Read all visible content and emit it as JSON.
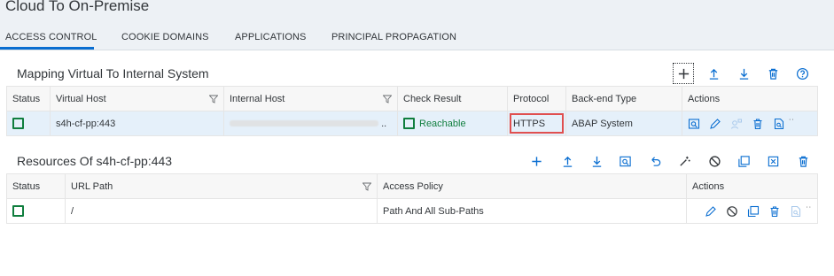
{
  "page": {
    "title": "Cloud To On-Premise"
  },
  "tabs": [
    {
      "label": "ACCESS CONTROL"
    },
    {
      "label": "COOKIE DOMAINS"
    },
    {
      "label": "APPLICATIONS"
    },
    {
      "label": "PRINCIPAL PROPAGATION"
    }
  ],
  "mapping": {
    "title": "Mapping Virtual To Internal System",
    "columns": {
      "status": "Status",
      "virtual_host": "Virtual Host",
      "internal_host": "Internal Host",
      "check_result": "Check Result",
      "protocol": "Protocol",
      "backend_type": "Back-end Type",
      "actions": "Actions"
    },
    "rows": [
      {
        "virtual_host": "s4h-cf-pp:443",
        "internal_host_suffix": "..",
        "check_result": "Reachable",
        "protocol": "HTTPS",
        "backend_type": "ABAP System"
      }
    ]
  },
  "resources": {
    "title": "Resources Of s4h-cf-pp:443",
    "columns": {
      "status": "Status",
      "url_path": "URL Path",
      "access_policy": "Access Policy",
      "actions": "Actions"
    },
    "rows": [
      {
        "url_path": "/",
        "access_policy": "Path And All Sub-Paths"
      }
    ]
  },
  "more_glyph": "˙˙",
  "colors": {
    "accent": "#0a6ed1",
    "success": "#107e3e",
    "highlight": "#e04f4f"
  }
}
